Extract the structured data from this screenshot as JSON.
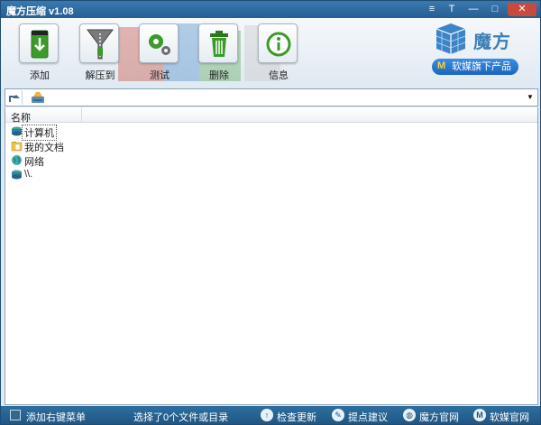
{
  "window": {
    "title": "魔方压缩 v1.08"
  },
  "titlebar_buttons": {
    "settings": "≡",
    "skin": "T",
    "minimize": "—",
    "maximize": "□",
    "close": "✕"
  },
  "toolbar": {
    "add_label": "添加",
    "extract_label": "解压到",
    "test_label": "测试",
    "delete_label": "删除",
    "info_label": "信息"
  },
  "brand": {
    "name": "魔方",
    "badge_icon": "M",
    "badge": "软媒旗下产品"
  },
  "pathbar": {
    "path_value": "",
    "dropdown_icon": "▼"
  },
  "filelist": {
    "column_name": "名称",
    "items": [
      {
        "label": "计算机",
        "icon": "drive-icon"
      },
      {
        "label": "我的文档",
        "icon": "folder-icon"
      },
      {
        "label": "网络",
        "icon": "globe-icon"
      },
      {
        "label": "\\\\.",
        "icon": "drive-icon"
      }
    ]
  },
  "statusbar": {
    "context_menu_label": "添加右键菜单",
    "selection_text": "选择了0个文件或目录",
    "check_update": "检查更新",
    "feedback": "提点建议",
    "mofang_site": "魔方官网",
    "ruanmei_site": "软媒官网",
    "ruanmei_icon": "M"
  },
  "colors": {
    "accent": "#275e92",
    "statusbar": "#1f5582",
    "tool_green": "#3c9a2a"
  }
}
